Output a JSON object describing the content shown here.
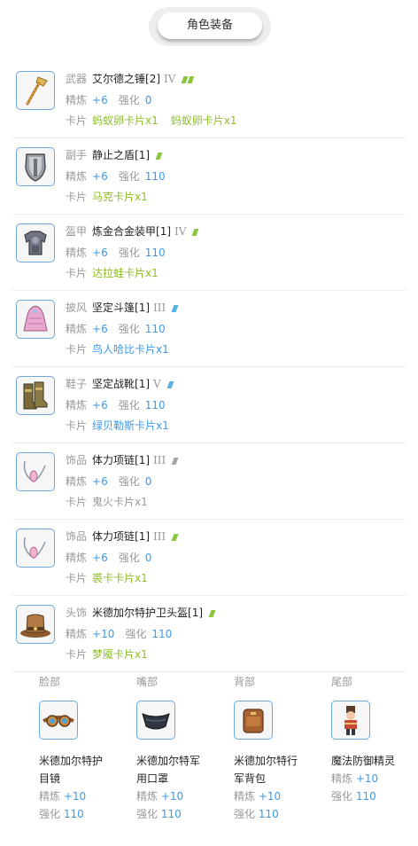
{
  "header": {
    "title": "角色装备"
  },
  "labels": {
    "refine": "精炼",
    "enhance": "强化",
    "card": "卡片"
  },
  "equipment": [
    {
      "slot": "武器",
      "name": "艾尔德之锤[2]",
      "tier": "IV",
      "rarity_color": "#8cc63f",
      "rarity_marks": 2,
      "refine": "+6",
      "enhance": "0",
      "cards": [
        "蚂蚁卵卡片x1",
        "蚂蚁卵卡片x1"
      ],
      "card_color": "#8cbf26",
      "icon": "hammer-icon"
    },
    {
      "slot": "副手",
      "name": "静止之盾[1]",
      "tier": "",
      "rarity_color": "#8cc63f",
      "rarity_marks": 1,
      "refine": "+6",
      "enhance": "110",
      "cards": [
        "马克卡片x1"
      ],
      "card_color": "#8cbf26",
      "icon": "shield-icon"
    },
    {
      "slot": "盔甲",
      "name": "炼金合金装甲[1]",
      "tier": "IV",
      "rarity_color": "#8cc63f",
      "rarity_marks": 1,
      "refine": "+6",
      "enhance": "110",
      "cards": [
        "达拉蛙卡片x1"
      ],
      "card_color": "#8cbf26",
      "icon": "armor-icon"
    },
    {
      "slot": "披风",
      "name": "坚定斗篷[1]",
      "tier": "III",
      "rarity_color": "#5aaee6",
      "rarity_marks": 1,
      "refine": "+6",
      "enhance": "110",
      "cards": [
        "鸟人哈比卡片x1"
      ],
      "card_color": "#3d9be9",
      "icon": "cloak-icon"
    },
    {
      "slot": "鞋子",
      "name": "坚定战靴[1]",
      "tier": "V",
      "rarity_color": "#5aaee6",
      "rarity_marks": 1,
      "refine": "+6",
      "enhance": "110",
      "cards": [
        "绿贝勒斯卡片x1"
      ],
      "card_color": "#3d9be9",
      "icon": "boots-icon"
    },
    {
      "slot": "饰品",
      "name": "体力项链[1]",
      "tier": "III",
      "rarity_color": "#a6a6a6",
      "rarity_marks": 1,
      "refine": "+6",
      "enhance": "0",
      "cards": [
        "鬼火卡片x1"
      ],
      "card_color": "#999999",
      "icon": "necklace-icon"
    },
    {
      "slot": "饰品",
      "name": "体力项链[1]",
      "tier": "III",
      "rarity_color": "#8cc63f",
      "rarity_marks": 1,
      "refine": "+6",
      "enhance": "0",
      "cards": [
        "裘卡卡片x1"
      ],
      "card_color": "#8cbf26",
      "icon": "necklace-icon"
    },
    {
      "slot": "头饰",
      "name": "米德加尔特护卫头盔[1]",
      "tier": "",
      "rarity_color": "#8cc63f",
      "rarity_marks": 1,
      "refine": "+10",
      "enhance": "110",
      "cards": [
        "梦魇卡片x1"
      ],
      "card_color": "#8cbf26",
      "icon": "hat-icon"
    }
  ],
  "cosmetics": [
    {
      "slot": "脸部",
      "name": "米德加尔特护目镜",
      "refine": "+10",
      "enhance": "110",
      "icon": "goggles-icon"
    },
    {
      "slot": "嘴部",
      "name": "米德加尔特军用口罩",
      "refine": "+10",
      "enhance": "110",
      "icon": "mask-icon"
    },
    {
      "slot": "背部",
      "name": "米德加尔特行军背包",
      "refine": "+10",
      "enhance": "110",
      "icon": "backpack-icon"
    },
    {
      "slot": "尾部",
      "name": "魔法防御精灵",
      "refine": "+10",
      "enhance": "110",
      "icon": "nutcracker-icon"
    }
  ]
}
